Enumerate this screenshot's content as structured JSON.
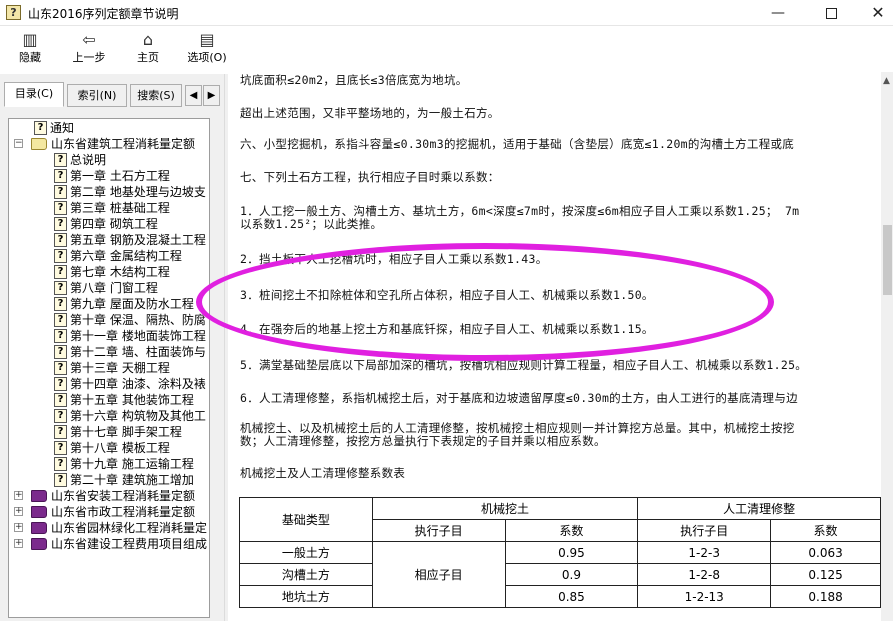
{
  "window": {
    "title": "山东2016序列定额章节说明",
    "minimize": "—",
    "close": "✕"
  },
  "toolbar": {
    "hide": "隐藏",
    "back": "上一步",
    "home": "主页",
    "options": "选项(O)"
  },
  "tabs": {
    "contents": "目录(C)",
    "index": "索引(N)",
    "search": "搜索(S)",
    "prev": "◀",
    "next": "▶"
  },
  "tree": {
    "notice": "通知",
    "building": "山东省建筑工程消耗量定额",
    "building_children": [
      "总说明",
      "第一章 土石方工程",
      "第二章 地基处理与边坡支",
      "第三章 桩基础工程",
      "第四章 砌筑工程",
      "第五章 钢筋及混凝土工程",
      "第六章 金属结构工程",
      "第七章 木结构工程",
      "第八章 门窗工程",
      "第九章 屋面及防水工程",
      "第十章 保温、隔热、防腐",
      "第十一章 楼地面装饰工程",
      "第十二章 墙、柱面装饰与",
      "第十三章 天棚工程",
      "第十四章 油漆、涂料及裱",
      "第十五章 其他装饰工程",
      "第十六章 构筑物及其他工",
      "第十七章 脚手架工程",
      "第十八章 模板工程",
      "第十九章 施工运输工程",
      "第二十章 建筑施工增加"
    ],
    "others": [
      "山东省安装工程消耗量定额",
      "山东省市政工程消耗量定额",
      "山东省园林绿化工程消耗量定",
      "山东省建设工程费用项目组成"
    ]
  },
  "content": {
    "lines": [
      "坑底面积≤20m2，且底长≤3倍底宽为地坑。",
      "超出上述范围，又非平整场地的，为一般土石方。",
      "六、小型挖掘机，系指斗容量≤0.30m3的挖掘机，适用于基础（含垫层）底宽≤1.20m的沟槽土方工程或底",
      "七、下列土石方工程，执行相应子目时乘以系数：",
      "1．人工挖一般土方、沟槽土方、基坑土方，6m<深度≤7m时，按深度≤6m相应子目人工乘以系数1.25； 7m",
      "以系数1.25²；以此类推。",
      "2．挡土板下人工挖槽坑时，相应子目人工乘以系数1.43。",
      "3．桩间挖土不扣除桩体和空孔所占体积，相应子目人工、机械乘以系数1.50。",
      "4．在强夯后的地基上挖土方和基底钎探，相应子目人工、机械乘以系数1.15。",
      "5．满堂基础垫层底以下局部加深的槽坑，按槽坑相应规则计算工程量，相应子目人工、机械乘以系数1.25。",
      "6．人工清理修整，系指机械挖土后，对于基底和边坡遗留厚度≤0.30m的土方，由人工进行的基底清理与边",
      "机械挖土、以及机械挖土后的人工清理修整，按机械挖土相应规则一并计算挖方总量。其中，机械挖土按挖",
      "数；人工清理修整，按挖方总量执行下表规定的子目并乘以相应系数。",
      "机械挖土及人工清理修整系数表"
    ]
  },
  "table": {
    "h_type": "基础类型",
    "h_machine": "机械挖土",
    "h_manual": "人工清理修整",
    "h_sub": "执行子目",
    "h_coef": "系数",
    "shared_sub": "相应子目",
    "rows": [
      {
        "type": "一般土方",
        "m_coef": "0.95",
        "r_sub": "1-2-3",
        "r_coef": "0.063"
      },
      {
        "type": "沟槽土方",
        "m_coef": "0.9",
        "r_sub": "1-2-8",
        "r_coef": "0.125"
      },
      {
        "type": "地坑土方",
        "m_coef": "0.85",
        "r_sub": "1-2-13",
        "r_coef": "0.188"
      }
    ]
  },
  "colors": {
    "highlight_ellipse": "#e020e0",
    "book_closed": "#7b2a8c"
  }
}
